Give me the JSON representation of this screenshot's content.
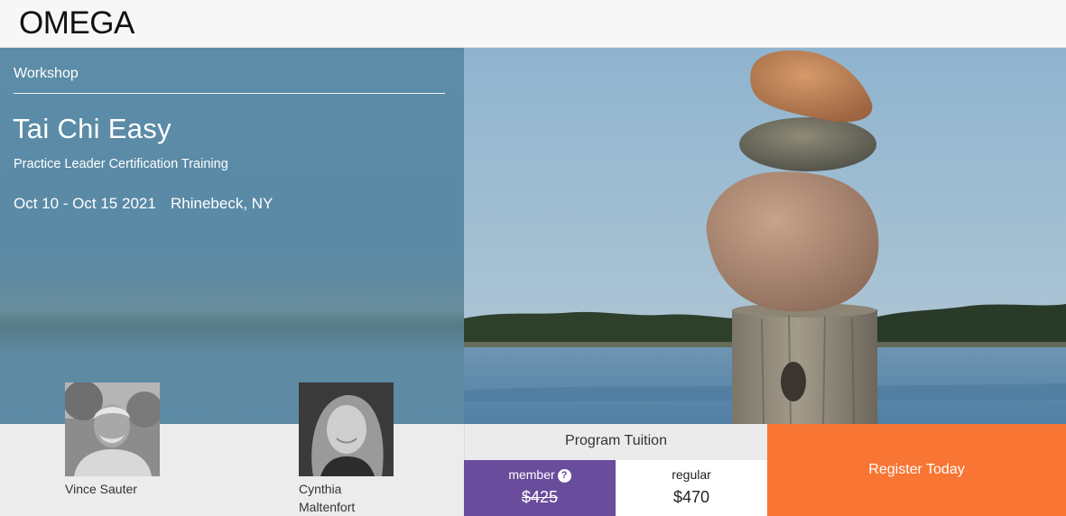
{
  "brand": {
    "logo_text": "OMEGA"
  },
  "hero": {
    "category": "Workshop",
    "title": "Tai Chi Easy",
    "subtitle": "Practice Leader Certification Training",
    "dates": "Oct 10 - Oct 15 2021",
    "location": "Rhinebeck, NY"
  },
  "instructors": [
    {
      "name": "Vince Sauter"
    },
    {
      "name_line1": "Cynthia",
      "name_line2": "Maltenfort"
    }
  ],
  "tuition": {
    "header": "Program Tuition",
    "member_label": "member",
    "member_price": "$425",
    "regular_label": "regular",
    "regular_price": "$470"
  },
  "cta": {
    "register_label": "Register Today"
  },
  "colors": {
    "hero_blue": "#5c8ca7",
    "member_purple": "#6a4c9c",
    "register_orange": "#f87533"
  },
  "icons": {
    "member_help": "question-circle-icon"
  }
}
